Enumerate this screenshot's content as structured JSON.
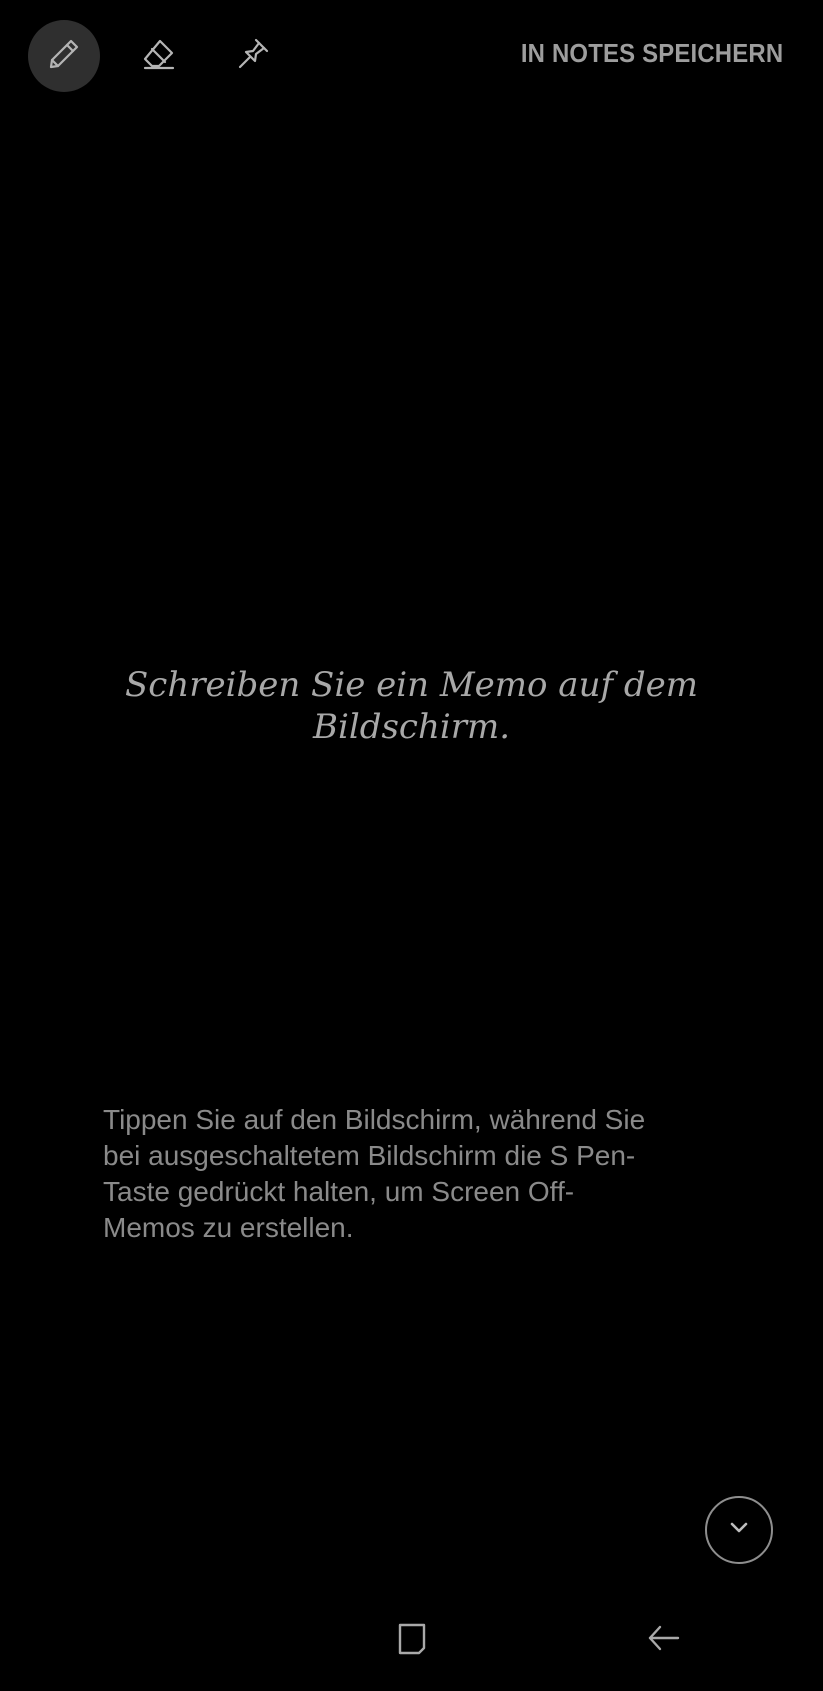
{
  "toolbar": {
    "tools": [
      {
        "name": "pen-icon",
        "active": true
      },
      {
        "name": "eraser-icon",
        "active": false
      },
      {
        "name": "pin-icon",
        "active": false
      }
    ],
    "save_label": "IN NOTES SPEICHERN"
  },
  "canvas": {
    "hint": "Schreiben Sie ein Memo auf dem Bildschirm.",
    "instruction": "Tippen Sie auf den Bildschirm, während Sie bei ausgeschaltetem Bildschirm die S Pen-Taste gedrückt halten, um Screen Off-Memos zu erstellen."
  },
  "controls": {
    "collapse_icon": "chevron-down-icon"
  },
  "navbar": {
    "items": [
      {
        "name": "recent-apps-icon"
      },
      {
        "name": "back-arrow-icon"
      }
    ]
  },
  "colors": {
    "background": "#000000",
    "text": "#a6a6a6",
    "active_tool_bg": "#2f2f2f"
  }
}
